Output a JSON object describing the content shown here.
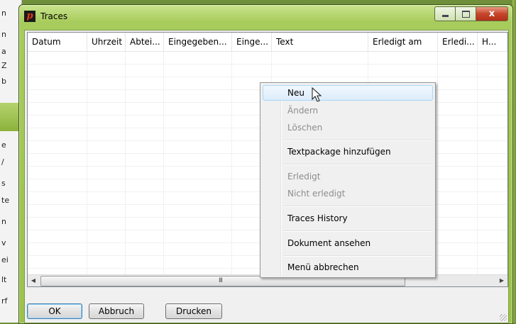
{
  "window": {
    "title": "Traces",
    "app_icon_letter": "p",
    "controls": {
      "close_glyph": "x"
    }
  },
  "background": {
    "side_letters": [
      "n",
      "n",
      "a",
      "Z",
      "b",
      "e",
      "/",
      "s",
      "te",
      "n",
      "v",
      "ei",
      "lt",
      "rf"
    ]
  },
  "grid": {
    "columns": [
      "Datum",
      "Uhrzeit",
      "Abtei...",
      "Eingegeben...",
      "Einge...",
      "Text",
      "Erledigt am",
      "Erledi...",
      "H..."
    ],
    "rows": [],
    "scroll_grip": "III"
  },
  "buttons": {
    "ok": "OK",
    "abbruch": "Abbruch",
    "drucken": "Drucken"
  },
  "context_menu": {
    "items": [
      {
        "label": "Neu",
        "enabled": true,
        "hovered": true
      },
      {
        "label": "Ändern",
        "enabled": false
      },
      {
        "label": "Löschen",
        "enabled": false
      },
      {
        "label": "Textpackage hinzufügen",
        "enabled": true
      },
      {
        "label": "Erledigt",
        "enabled": false
      },
      {
        "label": "Nicht erledigt",
        "enabled": false
      },
      {
        "label": "Traces History",
        "enabled": true
      },
      {
        "label": "Dokument ansehen",
        "enabled": true
      },
      {
        "label": "Menü abbrechen",
        "enabled": true
      }
    ]
  },
  "colors": {
    "titlebar_green": "#a8cc5c",
    "close_red": "#c7452b",
    "menu_hover": "#dcecfc"
  }
}
